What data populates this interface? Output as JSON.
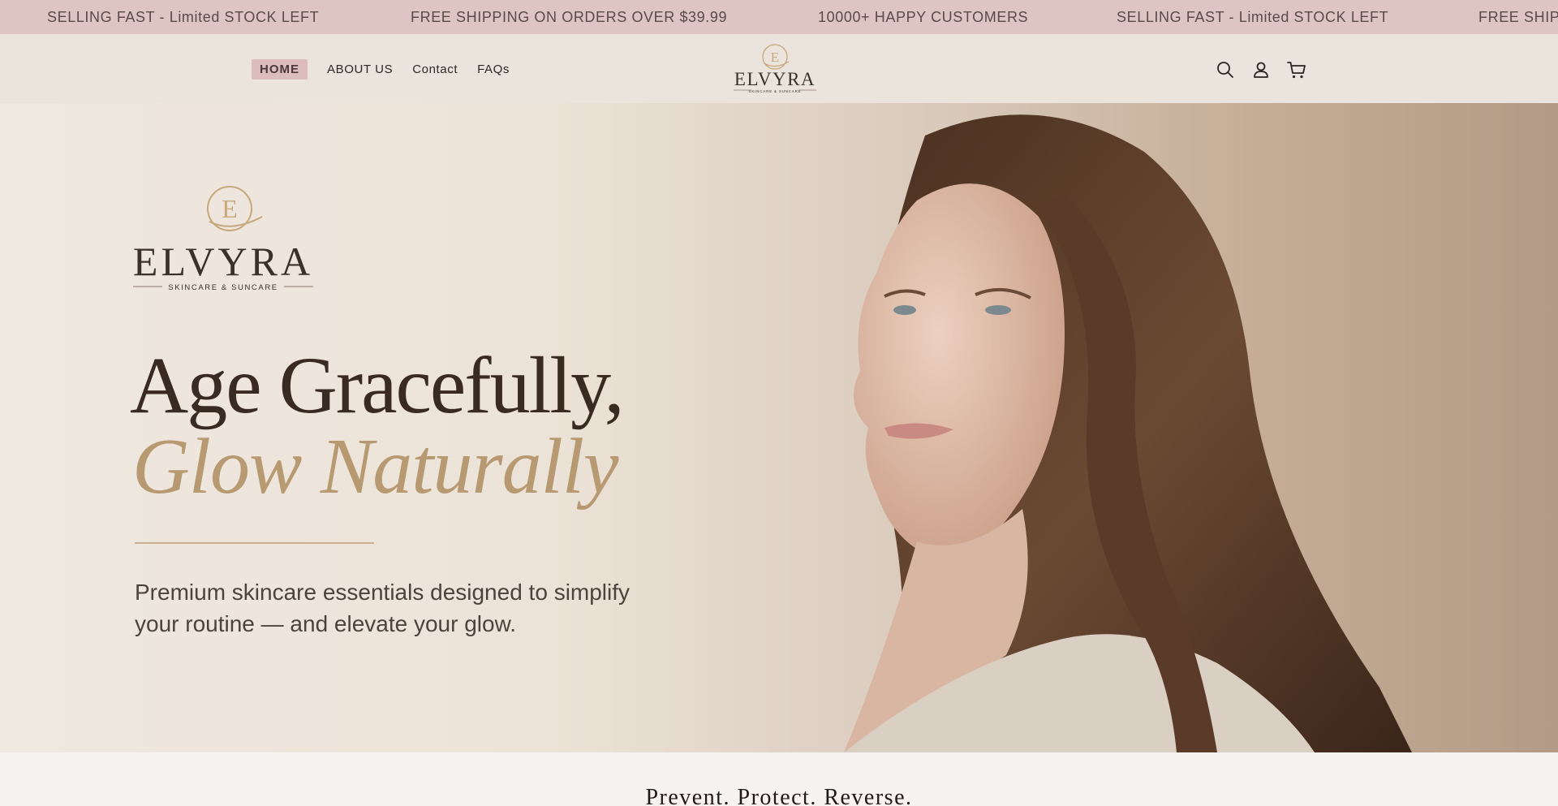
{
  "announcement": {
    "messages": [
      "SELLING FAST - Limited STOCK LEFT",
      "FREE SHIPPING ON ORDERS OVER $39.99",
      "10000+ HAPPY CUSTOMERS",
      "SELLING FAST - Limited STOCK LEFT",
      "FREE SHIP"
    ]
  },
  "header": {
    "nav": [
      "HOME",
      "ABOUT US",
      "Contact",
      "FAQs"
    ],
    "logo_text": "ELVYRA",
    "logo_tagline": "SKINCARE & SUNCARE",
    "icons": [
      "search-icon",
      "account-icon",
      "cart-icon"
    ]
  },
  "hero": {
    "logo_text": "ELVYRA",
    "logo_tagline": "SKINCARE & SUNCARE",
    "headline_line1": "Age Gracefully,",
    "headline_line2": "Glow Naturally",
    "subtext": "Premium skincare essentials designed to simplify your routine — and elevate your glow."
  },
  "section": {
    "title": "Prevent. Protect. Reverse."
  },
  "colors": {
    "announcement_bg": "#dfc4c4",
    "header_bg": "#ebe4dd",
    "accent_gold": "#b89a72",
    "headline_dark": "#3a2b22"
  }
}
